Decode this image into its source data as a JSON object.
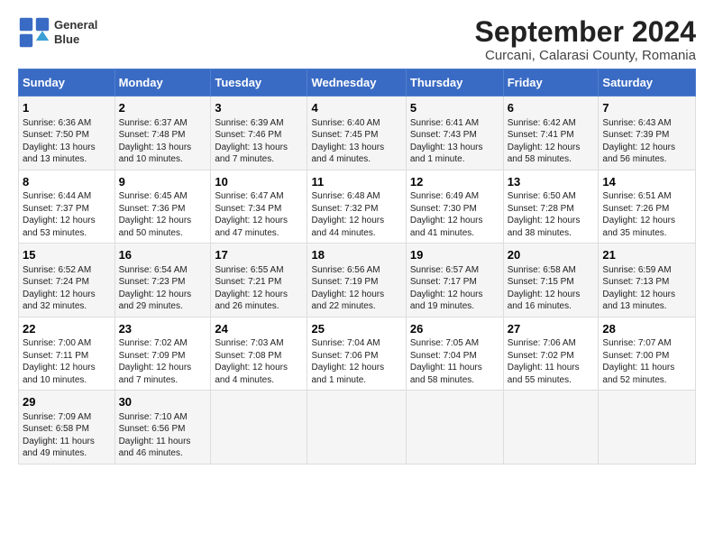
{
  "header": {
    "logo_line1": "General",
    "logo_line2": "Blue",
    "title": "September 2024",
    "subtitle": "Curcani, Calarasi County, Romania"
  },
  "weekdays": [
    "Sunday",
    "Monday",
    "Tuesday",
    "Wednesday",
    "Thursday",
    "Friday",
    "Saturday"
  ],
  "weeks": [
    [
      {
        "day": "1",
        "info": "Sunrise: 6:36 AM\nSunset: 7:50 PM\nDaylight: 13 hours\nand 13 minutes."
      },
      {
        "day": "2",
        "info": "Sunrise: 6:37 AM\nSunset: 7:48 PM\nDaylight: 13 hours\nand 10 minutes."
      },
      {
        "day": "3",
        "info": "Sunrise: 6:39 AM\nSunset: 7:46 PM\nDaylight: 13 hours\nand 7 minutes."
      },
      {
        "day": "4",
        "info": "Sunrise: 6:40 AM\nSunset: 7:45 PM\nDaylight: 13 hours\nand 4 minutes."
      },
      {
        "day": "5",
        "info": "Sunrise: 6:41 AM\nSunset: 7:43 PM\nDaylight: 13 hours\nand 1 minute."
      },
      {
        "day": "6",
        "info": "Sunrise: 6:42 AM\nSunset: 7:41 PM\nDaylight: 12 hours\nand 58 minutes."
      },
      {
        "day": "7",
        "info": "Sunrise: 6:43 AM\nSunset: 7:39 PM\nDaylight: 12 hours\nand 56 minutes."
      }
    ],
    [
      {
        "day": "8",
        "info": "Sunrise: 6:44 AM\nSunset: 7:37 PM\nDaylight: 12 hours\nand 53 minutes."
      },
      {
        "day": "9",
        "info": "Sunrise: 6:45 AM\nSunset: 7:36 PM\nDaylight: 12 hours\nand 50 minutes."
      },
      {
        "day": "10",
        "info": "Sunrise: 6:47 AM\nSunset: 7:34 PM\nDaylight: 12 hours\nand 47 minutes."
      },
      {
        "day": "11",
        "info": "Sunrise: 6:48 AM\nSunset: 7:32 PM\nDaylight: 12 hours\nand 44 minutes."
      },
      {
        "day": "12",
        "info": "Sunrise: 6:49 AM\nSunset: 7:30 PM\nDaylight: 12 hours\nand 41 minutes."
      },
      {
        "day": "13",
        "info": "Sunrise: 6:50 AM\nSunset: 7:28 PM\nDaylight: 12 hours\nand 38 minutes."
      },
      {
        "day": "14",
        "info": "Sunrise: 6:51 AM\nSunset: 7:26 PM\nDaylight: 12 hours\nand 35 minutes."
      }
    ],
    [
      {
        "day": "15",
        "info": "Sunrise: 6:52 AM\nSunset: 7:24 PM\nDaylight: 12 hours\nand 32 minutes."
      },
      {
        "day": "16",
        "info": "Sunrise: 6:54 AM\nSunset: 7:23 PM\nDaylight: 12 hours\nand 29 minutes."
      },
      {
        "day": "17",
        "info": "Sunrise: 6:55 AM\nSunset: 7:21 PM\nDaylight: 12 hours\nand 26 minutes."
      },
      {
        "day": "18",
        "info": "Sunrise: 6:56 AM\nSunset: 7:19 PM\nDaylight: 12 hours\nand 22 minutes."
      },
      {
        "day": "19",
        "info": "Sunrise: 6:57 AM\nSunset: 7:17 PM\nDaylight: 12 hours\nand 19 minutes."
      },
      {
        "day": "20",
        "info": "Sunrise: 6:58 AM\nSunset: 7:15 PM\nDaylight: 12 hours\nand 16 minutes."
      },
      {
        "day": "21",
        "info": "Sunrise: 6:59 AM\nSunset: 7:13 PM\nDaylight: 12 hours\nand 13 minutes."
      }
    ],
    [
      {
        "day": "22",
        "info": "Sunrise: 7:00 AM\nSunset: 7:11 PM\nDaylight: 12 hours\nand 10 minutes."
      },
      {
        "day": "23",
        "info": "Sunrise: 7:02 AM\nSunset: 7:09 PM\nDaylight: 12 hours\nand 7 minutes."
      },
      {
        "day": "24",
        "info": "Sunrise: 7:03 AM\nSunset: 7:08 PM\nDaylight: 12 hours\nand 4 minutes."
      },
      {
        "day": "25",
        "info": "Sunrise: 7:04 AM\nSunset: 7:06 PM\nDaylight: 12 hours\nand 1 minute."
      },
      {
        "day": "26",
        "info": "Sunrise: 7:05 AM\nSunset: 7:04 PM\nDaylight: 11 hours\nand 58 minutes."
      },
      {
        "day": "27",
        "info": "Sunrise: 7:06 AM\nSunset: 7:02 PM\nDaylight: 11 hours\nand 55 minutes."
      },
      {
        "day": "28",
        "info": "Sunrise: 7:07 AM\nSunset: 7:00 PM\nDaylight: 11 hours\nand 52 minutes."
      }
    ],
    [
      {
        "day": "29",
        "info": "Sunrise: 7:09 AM\nSunset: 6:58 PM\nDaylight: 11 hours\nand 49 minutes."
      },
      {
        "day": "30",
        "info": "Sunrise: 7:10 AM\nSunset: 6:56 PM\nDaylight: 11 hours\nand 46 minutes."
      },
      {
        "day": "",
        "info": ""
      },
      {
        "day": "",
        "info": ""
      },
      {
        "day": "",
        "info": ""
      },
      {
        "day": "",
        "info": ""
      },
      {
        "day": "",
        "info": ""
      }
    ]
  ]
}
